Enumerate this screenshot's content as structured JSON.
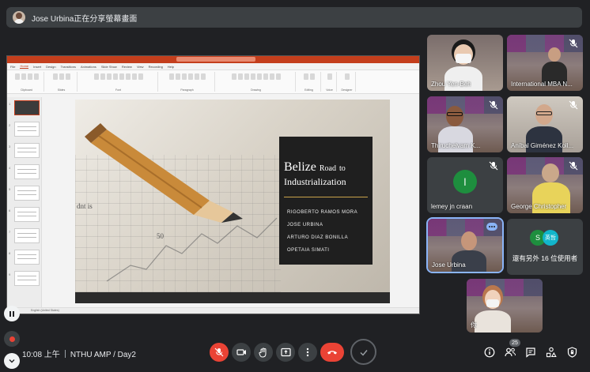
{
  "presenter_bar": {
    "text": "Jose Urbina正在分享螢幕畫面"
  },
  "ppt": {
    "window_title": "TL:TT - Industrial Management Program - PPt.ation",
    "tabs": [
      "File",
      "Home",
      "Insert",
      "Design",
      "Transitions",
      "Animations",
      "Slide Show",
      "Review",
      "View",
      "Recording",
      "Help"
    ],
    "active_tab": "Home",
    "ribbon_groups": [
      "Clipboard",
      "Slides",
      "Font",
      "Paragraph",
      "Drawing",
      "Editing",
      "Voice",
      "Designer"
    ],
    "status": "English (United States)",
    "slide_numbers": [
      "1",
      "2",
      "3",
      "4",
      "5",
      "6",
      "7",
      "8",
      "9"
    ],
    "slide": {
      "title_main": "Belize",
      "title_road": "Road",
      "title_to": "to",
      "title_line2": "Industrialization",
      "authors": [
        "RIGOBERTO RAMOS MORA",
        "JOSE URBINA",
        "ARTURO DIAZ BONILLA",
        "OPETAIA SIMATI"
      ],
      "chart_numbers": [
        "50",
        "dnt is"
      ]
    }
  },
  "participants": [
    {
      "name": "Zhou Yen-Beh",
      "muted": false
    },
    {
      "name": "International MBA N...",
      "muted": true
    },
    {
      "name": "Thiruchelvam K...",
      "muted": true
    },
    {
      "name": "Aníbal Giménez Koll...",
      "muted": true
    },
    {
      "name": "lemey jn craan",
      "muted": true,
      "initial": "l"
    },
    {
      "name": "George Christopher",
      "muted": true
    },
    {
      "name": "Jose Urbina",
      "muted": false
    },
    {
      "name": "你",
      "muted": false
    }
  ],
  "more_participants": {
    "avatar1": "S",
    "avatar2": "英哲",
    "text": "還有另外 16 位使用者"
  },
  "bottom": {
    "time": "10:08 上午",
    "meeting": "NTHU AMP / Day2",
    "people_count": "25"
  },
  "colors": {
    "accent": "#8ab4f8",
    "end_call": "#ea4335",
    "ppt_brand": "#c43e1c",
    "avatar_green": "#1e8e3e"
  }
}
